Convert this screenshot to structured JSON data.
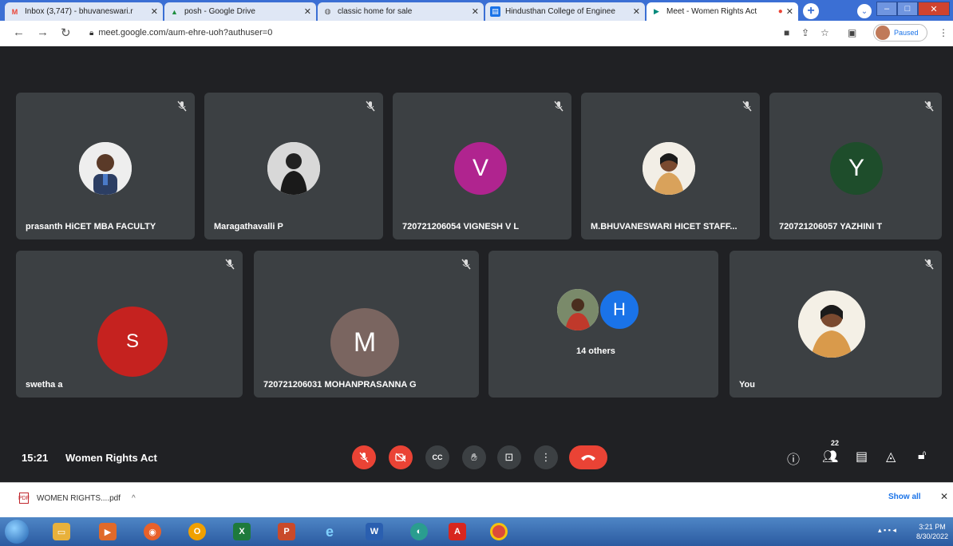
{
  "browser": {
    "tabs": [
      {
        "label": "Inbox (3,747) - bhuvaneswari.r",
        "icon": "gmail-icon",
        "color": "#ea4335"
      },
      {
        "label": "posh - Google Drive",
        "icon": "drive-icon",
        "color": "#1e8e3e"
      },
      {
        "label": "classic home for sale",
        "icon": "globe-icon",
        "color": "#555555"
      },
      {
        "label": "Hindusthan College of Enginee",
        "icon": "college-icon",
        "color": "#1a73e8"
      },
      {
        "label": "Meet - Women Rights Act",
        "icon": "meet-icon",
        "color": "#00897b"
      }
    ],
    "url": "meet.google.com/aum-ehre-uoh?authuser=0",
    "profile_status": "Paused",
    "new_tab_label": "+",
    "win_minimize": "–",
    "win_maximize": "□",
    "win_close": "✕"
  },
  "meet": {
    "participants_row1": [
      {
        "name": "prasanth HiCET MBA FACULTY",
        "avatar_type": "photo"
      },
      {
        "name": "Maragathavalli P",
        "avatar_type": "photo"
      },
      {
        "name": "720721206054 VIGNESH V L",
        "avatar_type": "initial",
        "initial": "V",
        "color": "#b0248f"
      },
      {
        "name": "M.BHUVANESWARI HICET STAFF...",
        "avatar_type": "photo"
      },
      {
        "name": "720721206057 YAZHINI T",
        "avatar_type": "initial",
        "initial": "Y",
        "color": "#1e4d2b"
      }
    ],
    "participants_row2": [
      {
        "name": "swetha a",
        "avatar_type": "initial",
        "initial": "S",
        "color": "#c5221f"
      },
      {
        "name": "720721206031 MOHANPRASANNA G",
        "avatar_type": "initial",
        "initial": "M",
        "color": "#7a6560"
      },
      {
        "name": "",
        "others_label": "14 others",
        "initial": "H",
        "color": "#1a73e8"
      },
      {
        "name": "You",
        "avatar_type": "photo"
      }
    ],
    "time": "15:21",
    "meeting_title": "Women Rights Act",
    "participant_count": "22"
  },
  "downloads": {
    "file": "WOMEN RIGHTS....pdf",
    "show_all": "Show all",
    "close": "✕"
  },
  "taskbar": {
    "clock_time": "3:21 PM",
    "clock_date": "8/30/2022"
  }
}
